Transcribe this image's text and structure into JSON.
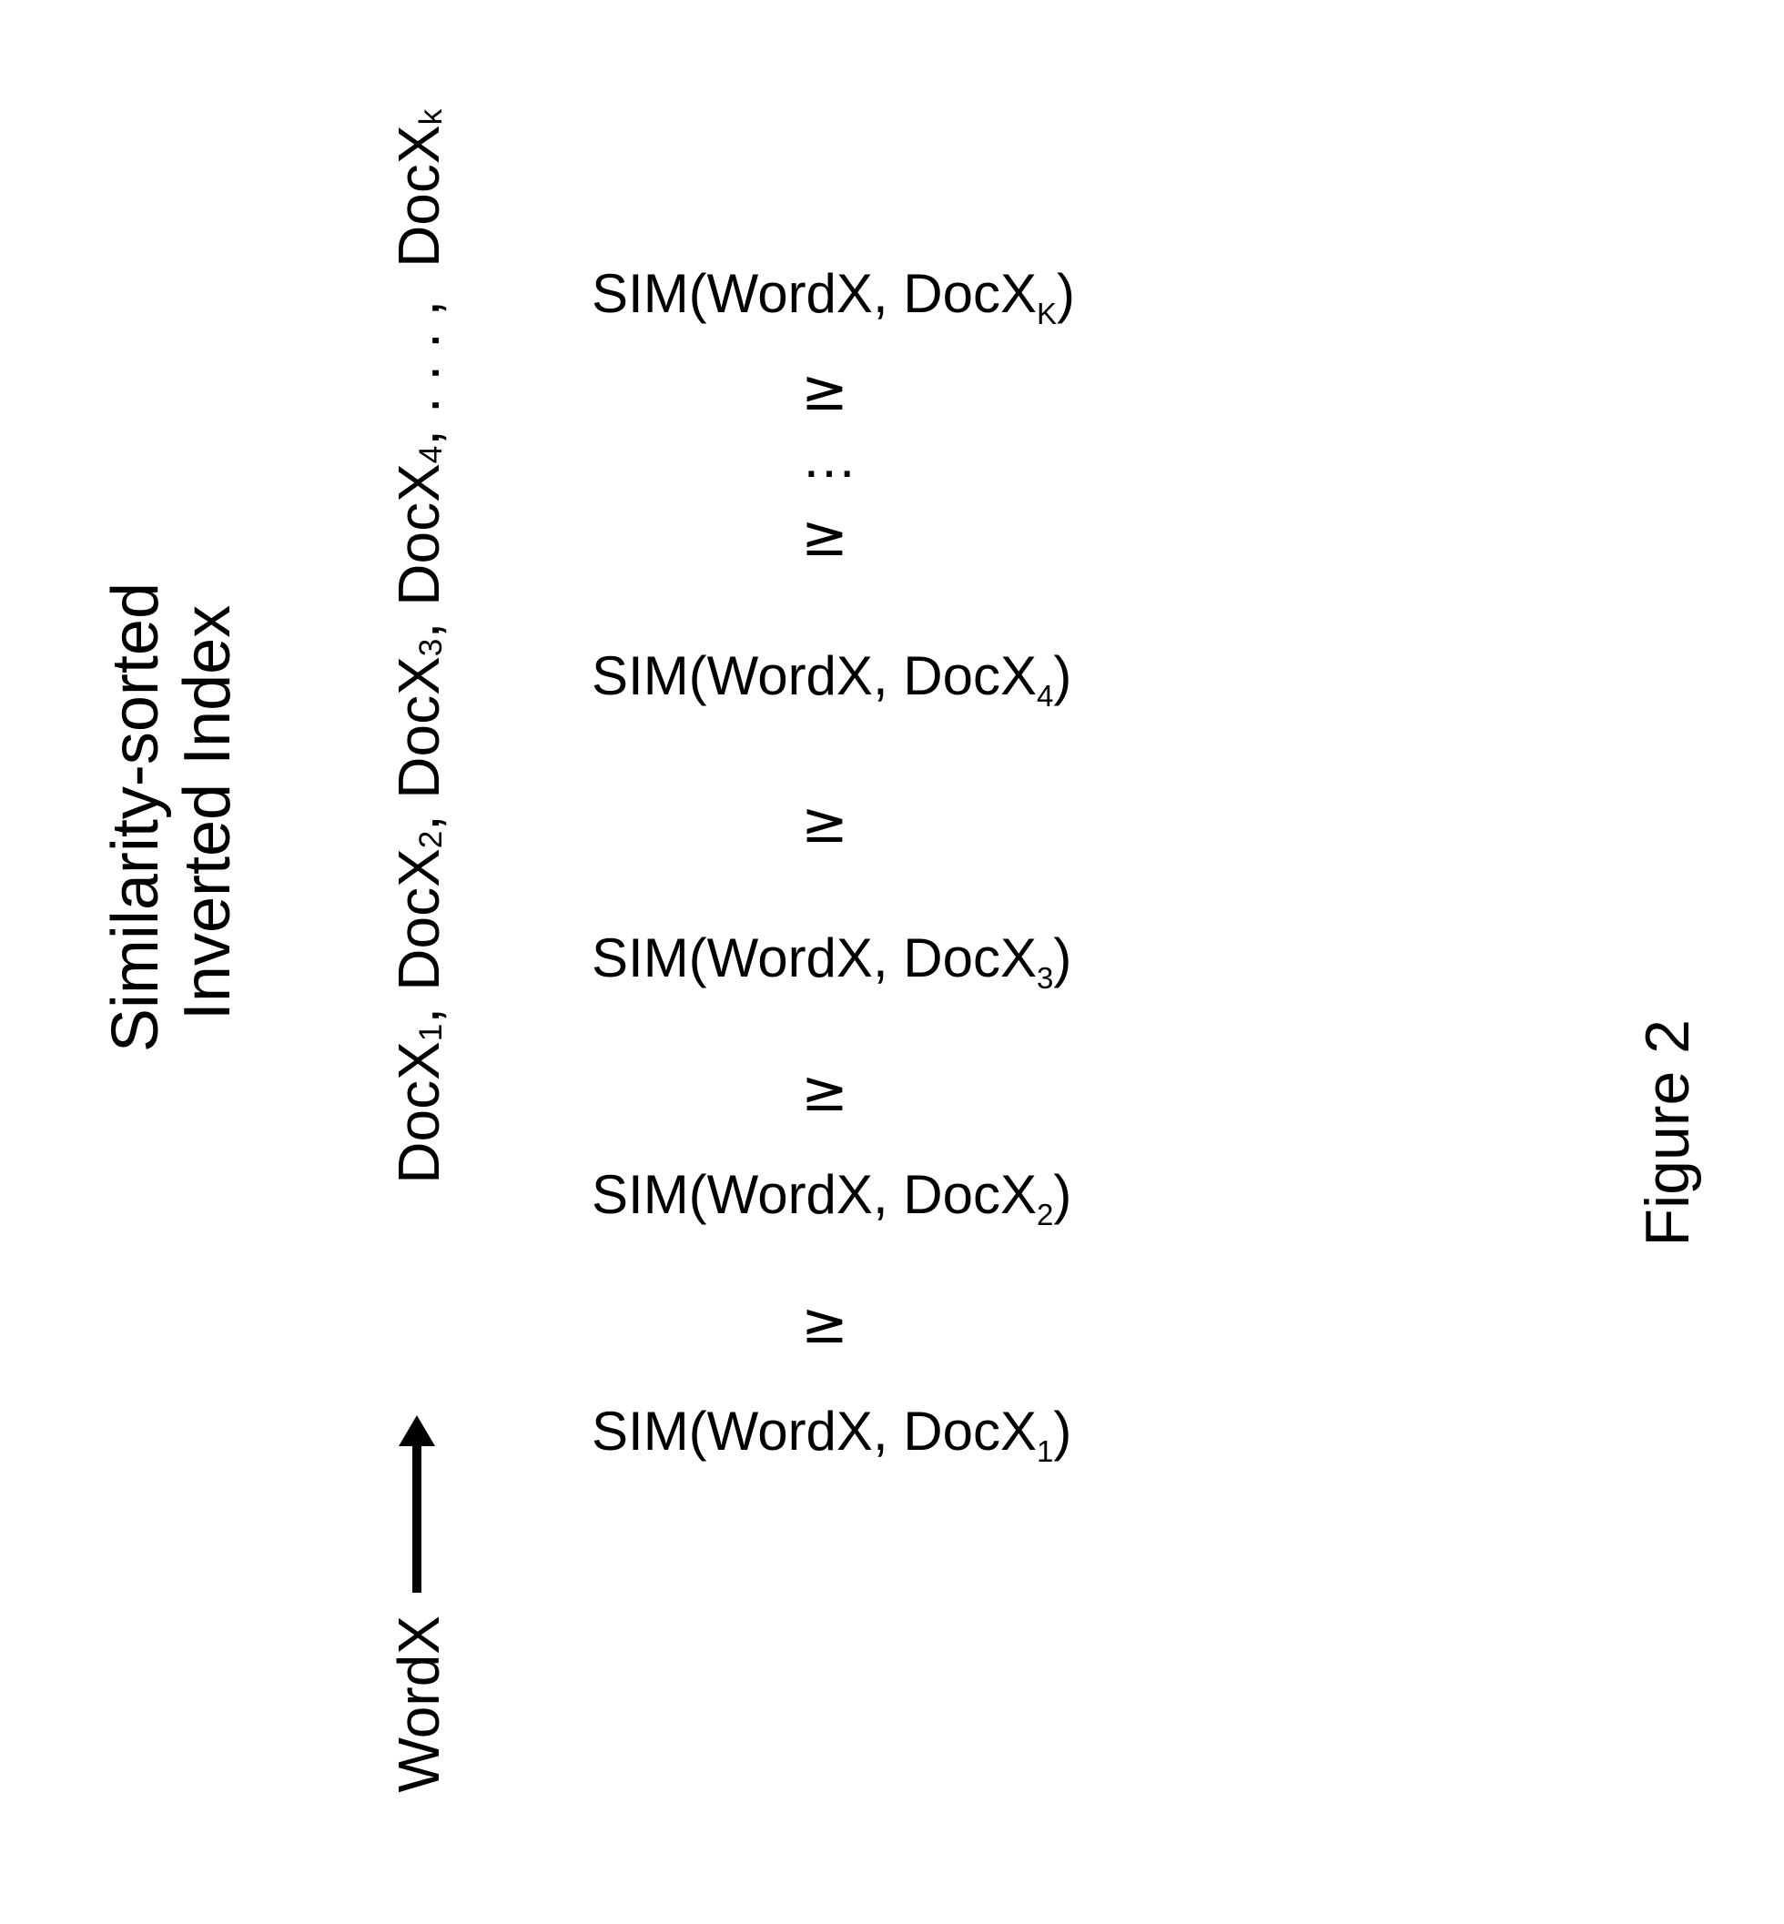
{
  "title": {
    "line1": "Similarity-sorted",
    "line2": "Inverted Index"
  },
  "caption": "Figure 2",
  "word_token": "WordX",
  "doc_prefix": "DocX",
  "subscripts": [
    "1",
    "2",
    "3",
    "4",
    "k",
    "K"
  ],
  "ellipsis": ". . . ,",
  "sep": ", ",
  "arrow_glyph": "→",
  "sim_fn": "SIM",
  "sim_args_prefix": "(WordX, DocX",
  "sim_args_suffix": ")",
  "geq": "≥",
  "dots_between": "…",
  "index_row_tail_sub": "k",
  "sim_last_sub": "K"
}
